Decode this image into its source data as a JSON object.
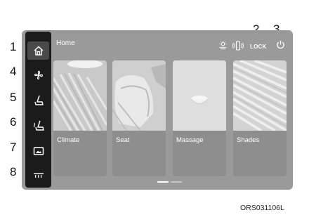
{
  "screen": {
    "title": "Home",
    "lock_label": "LOCK"
  },
  "callouts": [
    "1",
    "2",
    "3",
    "4",
    "5",
    "6",
    "7",
    "8"
  ],
  "sidebar": {
    "items": [
      {
        "icon": "home-icon",
        "active": true
      },
      {
        "icon": "fan-icon",
        "active": false
      },
      {
        "icon": "seat-icon",
        "active": false
      },
      {
        "icon": "seat-heat-icon",
        "active": false
      },
      {
        "icon": "screen-icon",
        "active": false
      },
      {
        "icon": "defrost-icon",
        "active": false
      }
    ]
  },
  "header_icons": [
    "sunshade-icon",
    "phone-mirror-icon",
    "lock-icon",
    "power-icon"
  ],
  "cards": [
    {
      "label": "Climate"
    },
    {
      "label": "Seat"
    },
    {
      "label": "Massage"
    },
    {
      "label": "Shades"
    }
  ],
  "pagination": {
    "pages": 2,
    "current": 1
  },
  "image_code": "ORS031106L"
}
